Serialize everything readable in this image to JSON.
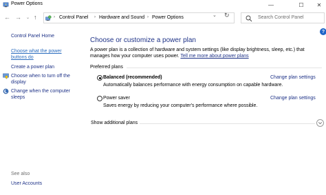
{
  "window": {
    "title": "Power Options",
    "minimize_glyph": "—",
    "maximize_glyph": "☐",
    "close_glyph": "✕"
  },
  "address": {
    "back_glyph": "←",
    "forward_glyph": "→",
    "recent_glyph": "⌄",
    "up_glyph": "↑",
    "breadcrumbs": [
      "Control Panel",
      "Hardware and Sound",
      "Power Options"
    ],
    "separator": "›",
    "dropdown_glyph": "⌄",
    "refresh_glyph": "↻",
    "search_placeholder": "Search Control Panel"
  },
  "sidebar": {
    "home": "Control Panel Home",
    "links": [
      {
        "line1": "Choose what the power",
        "line2": "buttons do"
      },
      {
        "line1": "Create a power plan"
      },
      {
        "line1": "Choose when to turn off the",
        "line2": "display"
      },
      {
        "line1": "Change when the computer",
        "line2": "sleeps"
      }
    ],
    "see_also": "See also",
    "user_accounts": "User Accounts"
  },
  "main": {
    "heading": "Choose or customize a power plan",
    "description": "A power plan is a collection of hardware and system settings (like display brightness, sleep, etc.) that manages how your computer uses power.",
    "description_link": "Tell me more about power plans",
    "group_label": "Preferred plans",
    "plans": [
      {
        "name": "Balanced (recommended)",
        "desc": "Automatically balances performance with energy consumption on capable hardware.",
        "change": "Change plan settings",
        "selected": true
      },
      {
        "name": "Power saver",
        "desc": "Saves energy by reducing your computer's performance where possible.",
        "change": "Change plan settings",
        "selected": false
      }
    ],
    "show_more": "Show additional plans",
    "expand_glyph": "⌄",
    "help_glyph": "?"
  },
  "colors": {
    "link": "#1e3287",
    "active_link": "#2a6cbe",
    "help": "#1e64c8"
  },
  "icons": [
    "power-options-icon",
    "control-panel-icon",
    "search-icon",
    "shield-icon",
    "moon-globe-icon"
  ]
}
